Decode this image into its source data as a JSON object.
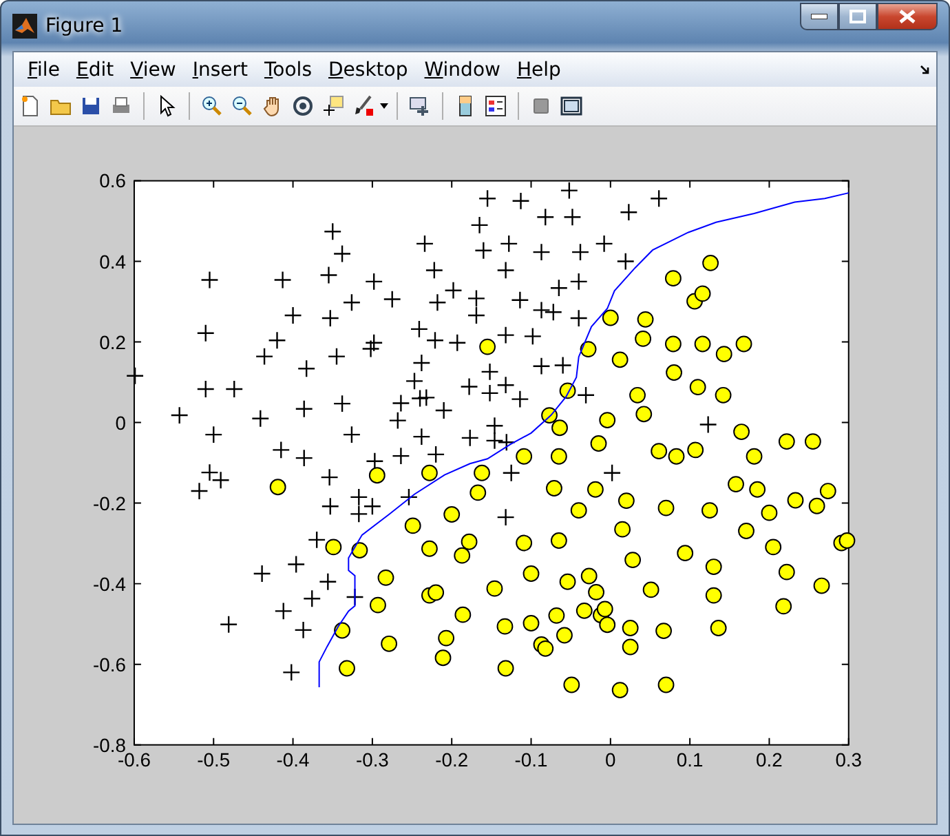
{
  "window": {
    "title": "Figure 1"
  },
  "menu": [
    "File",
    "Edit",
    "View",
    "Insert",
    "Tools",
    "Desktop",
    "Window",
    "Help"
  ],
  "figure": {
    "chart_data": {
      "type": "scatter",
      "xlim": [
        -0.6,
        0.3
      ],
      "ylim": [
        -0.8,
        0.6
      ],
      "xticks": [
        {
          "value": -0.6,
          "label": "-0.6"
        },
        {
          "value": -0.5,
          "label": "-0.5"
        },
        {
          "value": -0.4,
          "label": "-0.4"
        },
        {
          "value": -0.3,
          "label": "-0.3"
        },
        {
          "value": -0.2,
          "label": "-0.2"
        },
        {
          "value": -0.1,
          "label": "-0.1"
        },
        {
          "value": 0,
          "label": "0"
        },
        {
          "value": 0.1,
          "label": "0.1"
        },
        {
          "value": 0.2,
          "label": "0.2"
        },
        {
          "value": 0.3,
          "label": "0.3"
        }
      ],
      "yticks": [
        {
          "value": -0.8,
          "label": "-0.8"
        },
        {
          "value": -0.6,
          "label": "-0.6"
        },
        {
          "value": -0.4,
          "label": "-0.4"
        },
        {
          "value": -0.2,
          "label": "-0.2"
        },
        {
          "value": 0,
          "label": "0"
        },
        {
          "value": 0.2,
          "label": "0.2"
        },
        {
          "value": 0.4,
          "label": "0.4"
        },
        {
          "value": 0.6,
          "label": "0.6"
        }
      ],
      "series": [
        {
          "type": "scatter",
          "marker": "plus",
          "color": "#000000",
          "x": [
            -0.155,
            -0.113,
            -0.052,
            0.061,
            0.023,
            -0.082,
            -0.048,
            -0.165,
            -0.35,
            -0.234,
            -0.128,
            -0.008,
            -0.338,
            -0.16,
            -0.087,
            -0.038,
            0.019,
            -0.505,
            -0.413,
            -0.298,
            -0.355,
            -0.222,
            -0.132,
            -0.04,
            -0.065,
            -0.198,
            -0.326,
            -0.275,
            -0.218,
            -0.169,
            -0.114,
            -0.169,
            -0.087,
            -0.072,
            -0.04,
            -0.4,
            -0.353,
            -0.51,
            -0.42,
            -0.241,
            -0.221,
            -0.193,
            -0.132,
            -0.098,
            -0.298,
            -0.302,
            -0.436,
            -0.345,
            -0.383,
            -0.238,
            -0.247,
            -0.152,
            -0.087,
            -0.06,
            -0.599,
            -0.51,
            -0.474,
            -0.178,
            -0.152,
            -0.132,
            -0.114,
            -0.031,
            -0.24,
            -0.232,
            -0.264,
            -0.268,
            -0.338,
            -0.386,
            -0.21,
            -0.543,
            -0.441,
            -0.5,
            -0.326,
            -0.238,
            -0.177,
            -0.146,
            -0.146,
            -0.131,
            0.123,
            -0.415,
            -0.386,
            -0.297,
            -0.264,
            -0.22,
            -0.505,
            -0.491,
            -0.518,
            -0.354,
            -0.125,
            0.002,
            -0.317,
            -0.353,
            -0.3,
            -0.317,
            -0.254,
            -0.132,
            -0.37,
            -0.439,
            -0.396,
            -0.356,
            -0.376,
            -0.322,
            -0.412,
            -0.481,
            -0.387,
            -0.402
          ],
          "values": [
            0.556,
            0.55,
            0.576,
            0.556,
            0.522,
            0.51,
            0.51,
            0.49,
            0.474,
            0.444,
            0.444,
            0.444,
            0.419,
            0.427,
            0.423,
            0.423,
            0.4,
            0.354,
            0.354,
            0.35,
            0.366,
            0.378,
            0.378,
            0.35,
            0.334,
            0.328,
            0.298,
            0.306,
            0.298,
            0.308,
            0.304,
            0.266,
            0.279,
            0.274,
            0.259,
            0.266,
            0.259,
            0.222,
            0.204,
            0.232,
            0.204,
            0.198,
            0.217,
            0.214,
            0.198,
            0.183,
            0.164,
            0.164,
            0.134,
            0.148,
            0.103,
            0.126,
            0.14,
            0.142,
            0.116,
            0.083,
            0.083,
            0.089,
            0.073,
            0.093,
            0.058,
            0.068,
            0.06,
            0.062,
            0.048,
            0.005,
            0.047,
            0.034,
            0.03,
            0.018,
            0.01,
            -0.03,
            -0.03,
            -0.035,
            -0.038,
            -0.008,
            -0.045,
            -0.049,
            -0.005,
            -0.068,
            -0.088,
            -0.096,
            -0.083,
            -0.079,
            -0.124,
            -0.143,
            -0.17,
            -0.136,
            -0.125,
            -0.125,
            -0.185,
            -0.208,
            -0.208,
            -0.227,
            -0.185,
            -0.235,
            -0.291,
            -0.375,
            -0.352,
            -0.395,
            -0.437,
            -0.433,
            -0.468,
            -0.501,
            -0.515,
            -0.62
          ]
        },
        {
          "type": "scatter",
          "marker": "circle",
          "color": "#ffff00",
          "x": [
            0.126,
            0.079,
            0.106,
            0.116,
            0,
            0.044,
            -0.155,
            -0.028,
            0.041,
            0.079,
            0.116,
            0.168,
            0.143,
            0.012,
            0.08,
            0.11,
            -0.054,
            0.034,
            0.142,
            -0.077,
            -0.004,
            0.042,
            -0.064,
            0.165,
            -0.015,
            0.222,
            0.255,
            -0.109,
            -0.065,
            0.061,
            0.083,
            0.107,
            0.181,
            -0.294,
            -0.228,
            -0.162,
            -0.419,
            -0.167,
            -0.071,
            -0.019,
            0.02,
            0.158,
            0.185,
            0.233,
            0.26,
            0.274,
            0.07,
            0.125,
            0.2,
            -0.04,
            -0.2,
            -0.249,
            0.015,
            0.171,
            -0.349,
            -0.316,
            -0.228,
            -0.178,
            -0.187,
            -0.109,
            -0.065,
            0.028,
            0.094,
            0.205,
            0.291,
            0.298,
            -0.283,
            -0.1,
            -0.027,
            0.13,
            0.222,
            -0.146,
            -0.054,
            -0.018,
            0.051,
            0.266,
            -0.228,
            -0.22,
            0.13,
            -0.293,
            0.218,
            -0.186,
            -0.068,
            -0.033,
            -0.012,
            -0.007,
            -0.004,
            -0.338,
            -0.133,
            -0.1,
            -0.058,
            0.025,
            0.067,
            0.136,
            -0.279,
            -0.207,
            -0.087,
            -0.082,
            0.025,
            -0.332,
            -0.211,
            -0.132,
            -0.049,
            0.012,
            0.07
          ],
          "values": [
            0.396,
            0.358,
            0.301,
            0.32,
            0.26,
            0.256,
            0.188,
            0.182,
            0.208,
            0.195,
            0.195,
            0.195,
            0.17,
            0.156,
            0.124,
            0.088,
            0.079,
            0.068,
            0.068,
            0.018,
            0.006,
            0.021,
            -0.013,
            -0.023,
            -0.052,
            -0.047,
            -0.047,
            -0.084,
            -0.084,
            -0.071,
            -0.084,
            -0.068,
            -0.084,
            -0.131,
            -0.125,
            -0.125,
            -0.16,
            -0.174,
            -0.163,
            -0.166,
            -0.194,
            -0.153,
            -0.166,
            -0.193,
            -0.207,
            -0.17,
            -0.212,
            -0.218,
            -0.224,
            -0.218,
            -0.228,
            -0.256,
            -0.265,
            -0.269,
            -0.309,
            -0.317,
            -0.313,
            -0.296,
            -0.33,
            -0.299,
            -0.293,
            -0.341,
            -0.324,
            -0.309,
            -0.299,
            -0.293,
            -0.385,
            -0.375,
            -0.381,
            -0.358,
            -0.371,
            -0.412,
            -0.395,
            -0.421,
            -0.415,
            -0.405,
            -0.429,
            -0.422,
            -0.429,
            -0.453,
            -0.456,
            -0.477,
            -0.479,
            -0.467,
            -0.478,
            -0.463,
            -0.502,
            -0.516,
            -0.506,
            -0.498,
            -0.528,
            -0.51,
            -0.517,
            -0.51,
            -0.549,
            -0.535,
            -0.551,
            -0.561,
            -0.557,
            -0.61,
            -0.584,
            -0.61,
            -0.651,
            -0.664,
            -0.651
          ]
        },
        {
          "type": "line",
          "color": "#0000ff",
          "x": [
            -0.367,
            -0.367,
            -0.357,
            -0.343,
            -0.33,
            -0.322,
            -0.322,
            -0.33,
            -0.33,
            -0.313,
            -0.279,
            -0.247,
            -0.209,
            -0.177,
            -0.155,
            -0.126,
            -0.1,
            -0.075,
            -0.056,
            -0.043,
            -0.04,
            -0.024,
            -0.004,
            0.005,
            0.031,
            0.053,
            0.098,
            0.133,
            0.181,
            0.232,
            0.27,
            0.3
          ],
          "values": [
            -0.657,
            -0.594,
            -0.556,
            -0.506,
            -0.468,
            -0.455,
            -0.38,
            -0.367,
            -0.336,
            -0.279,
            -0.228,
            -0.178,
            -0.13,
            -0.102,
            -0.09,
            -0.054,
            -0.026,
            0.018,
            0.064,
            0.112,
            0.163,
            0.238,
            0.283,
            0.327,
            0.384,
            0.428,
            0.472,
            0.497,
            0.519,
            0.547,
            0.556,
            0.57
          ]
        }
      ]
    }
  }
}
